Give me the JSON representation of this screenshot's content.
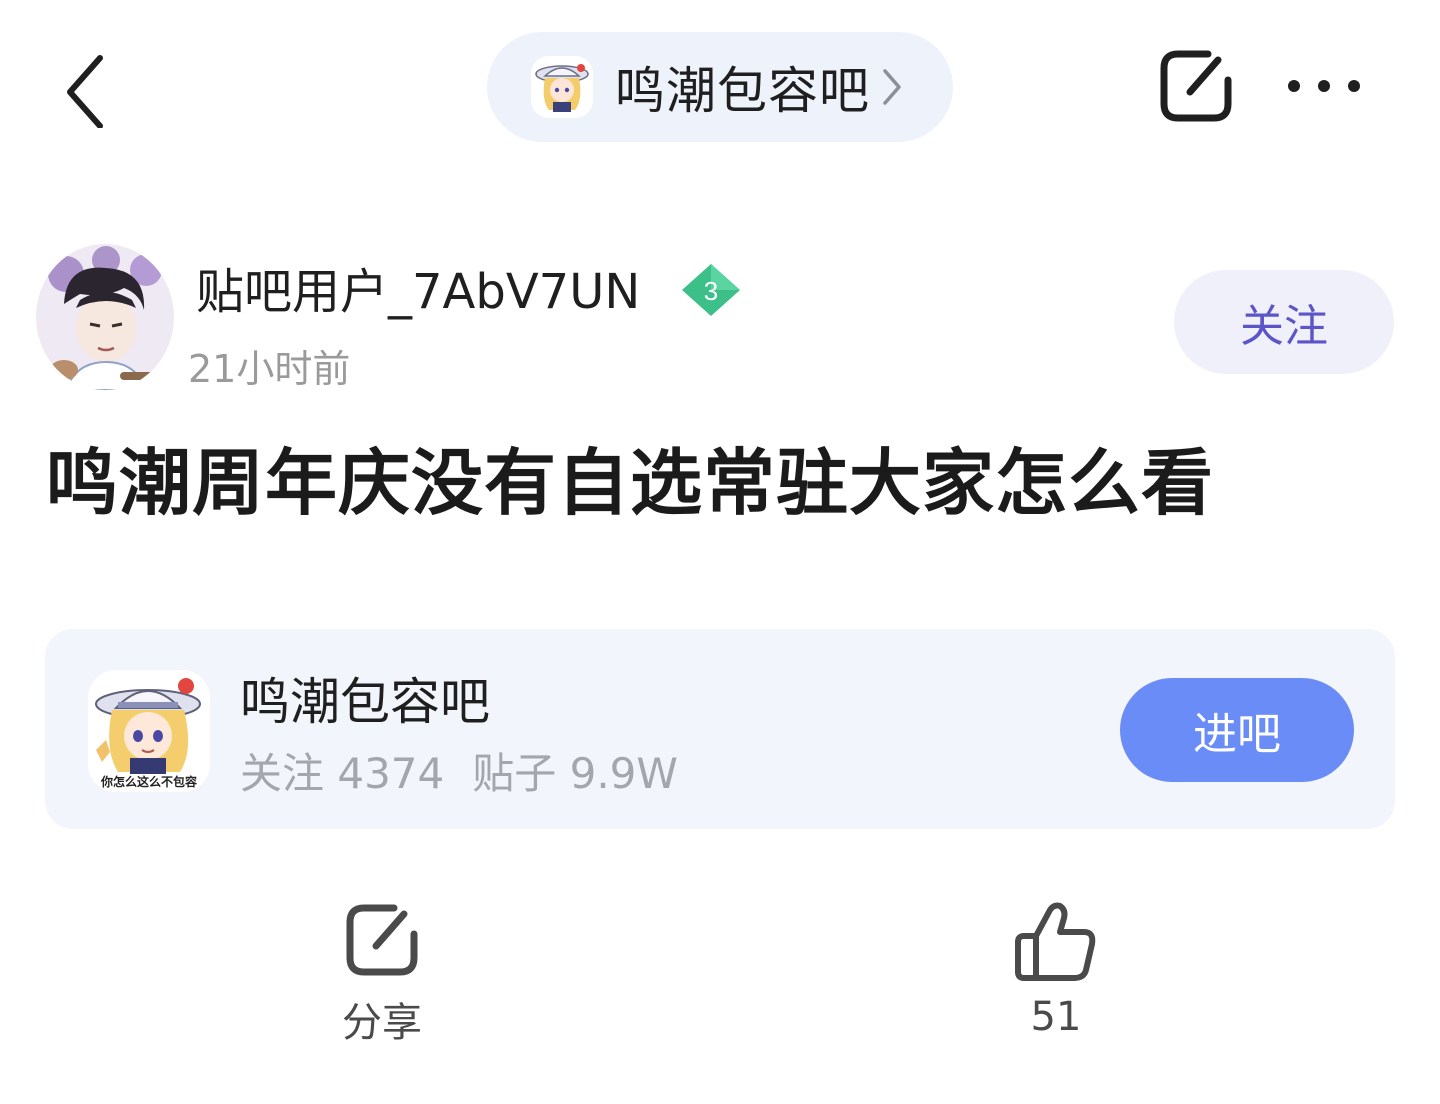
{
  "header": {
    "forum_name": "鸣潮包容吧",
    "icons": {
      "back": "chevron-left-icon",
      "chevron": "chevron-right-icon",
      "share": "share-icon",
      "more": "more-dots-icon"
    }
  },
  "author": {
    "name": "贴吧用户_7AbV7UN",
    "level": "3",
    "time": "21小时前",
    "follow_label": "关注"
  },
  "post": {
    "title": "鸣潮周年庆没有自选常驻大家怎么看"
  },
  "forum_card": {
    "name": "鸣潮包容吧",
    "avatar_caption": "你怎么这么不包容",
    "followers": "关注 4374",
    "posts": "贴子 9.9W",
    "enter_label": "进吧"
  },
  "actions": {
    "share_label": "分享",
    "like_count": "51"
  },
  "colors": {
    "accent_blue": "#6a8cf7",
    "follow_text": "#5b55c8",
    "pill_bg": "#eef2fb",
    "card_bg": "#f2f5fc",
    "level_badge": "#3dbf8a"
  }
}
